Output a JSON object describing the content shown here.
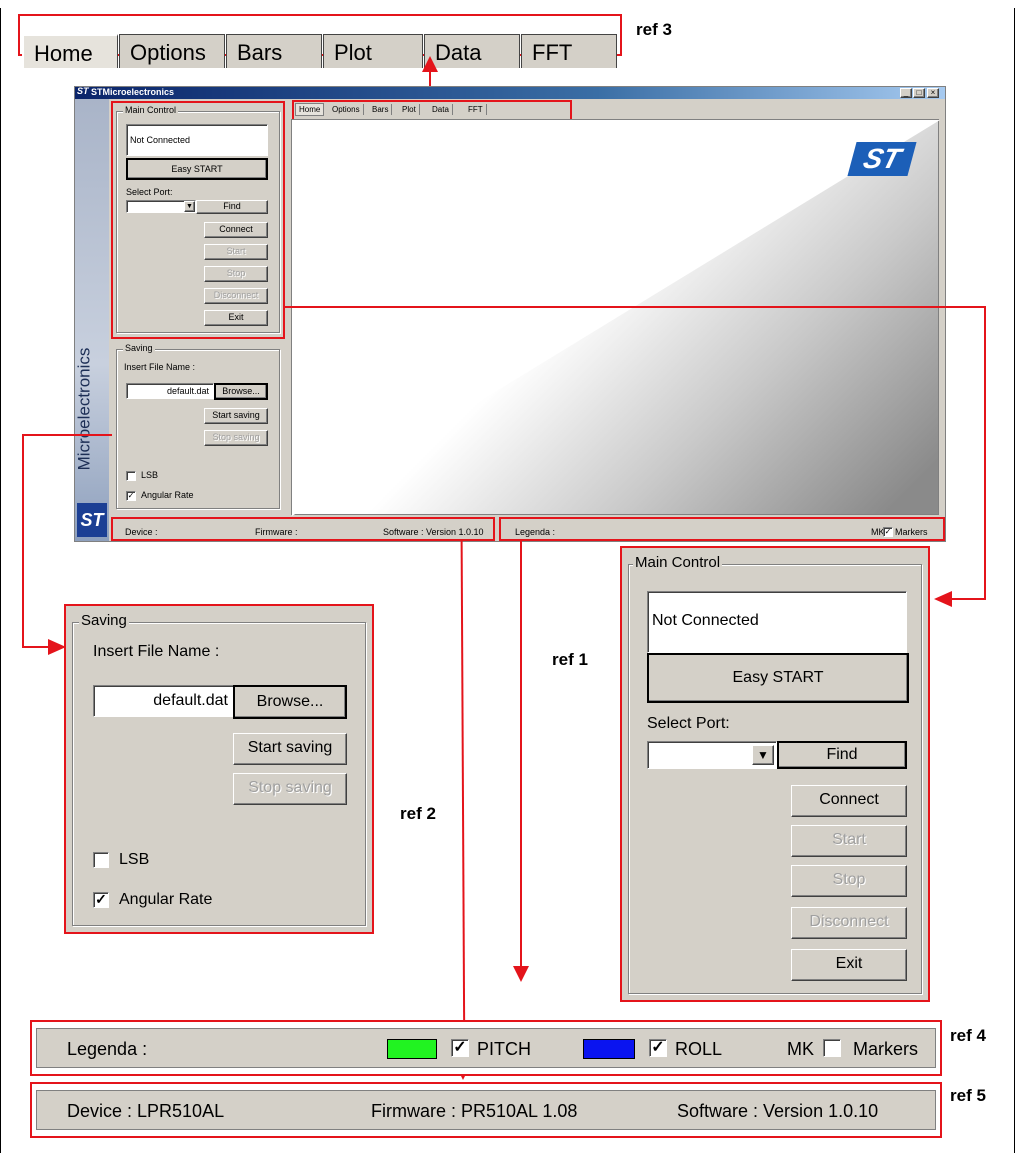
{
  "tabs": [
    "Home",
    "Options",
    "Bars",
    "Plot",
    "Data",
    "FFT"
  ],
  "refs": {
    "r1": "ref 1",
    "r2": "ref 2",
    "r3": "ref 3",
    "r4": "ref 4",
    "r5": "ref 5"
  },
  "app": {
    "title": "STMicroelectronics",
    "vertical_brand": "Microelectronics",
    "main_control": {
      "title": "Main Control",
      "status": "Not Connected",
      "easy_start": "Easy START",
      "select_port_label": "Select Port:",
      "find": "Find",
      "connect": "Connect",
      "start": "Start",
      "stop": "Stop",
      "disconnect": "Disconnect",
      "exit": "Exit"
    },
    "saving": {
      "title": "Saving",
      "file_label": "Insert File Name :",
      "file_value": "default.dat",
      "browse": "Browse...",
      "start_saving": "Start saving",
      "stop_saving": "Stop saving",
      "lsb": "LSB",
      "angular_rate": "Angular Rate"
    },
    "status_small": {
      "device": "Device :",
      "firmware": "Firmware :",
      "software": "Software : Version 1.0.10",
      "legenda": "Legenda :",
      "mk": "MK",
      "markers": "Markers"
    }
  },
  "legend_bar": {
    "label": "Legenda :",
    "pitch": "PITCH",
    "roll": "ROLL",
    "mk": "MK",
    "markers": "Markers",
    "pitch_color": "#21f321",
    "roll_color": "#0a14f0"
  },
  "device_bar": {
    "device": "Device :  LPR510AL",
    "firmware": "Firmware :  PR510AL 1.08",
    "software": "Software :  Version 1.0.10"
  }
}
